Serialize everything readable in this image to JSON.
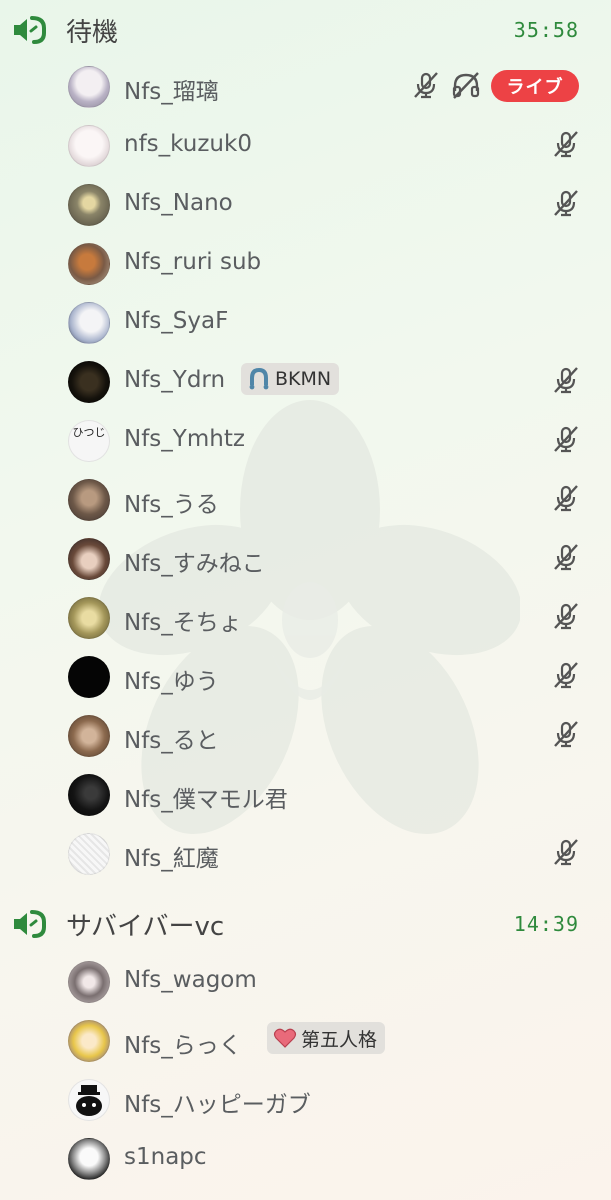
{
  "channels": [
    {
      "name": "待機",
      "timer": "35:58",
      "icon": "speaker-icon",
      "color": "#2f8a3d",
      "members": [
        {
          "name": "Nfs_瑠璃",
          "avatar_color": "#c9c5d3",
          "muted": true,
          "deafened": true,
          "live": true,
          "live_label": "ライブ"
        },
        {
          "name": "nfs_kuzuk0",
          "avatar_color": "#efe9ea",
          "muted": true
        },
        {
          "name": "Nfs_Nano",
          "avatar_color": "#6e6a5a",
          "muted": true
        },
        {
          "name": "Nfs_ruri sub",
          "avatar_color": "#8a6f55",
          "muted": false
        },
        {
          "name": "Nfs_SyaF",
          "avatar_color": "#d6dce8",
          "muted": false
        },
        {
          "name": "Nfs_Ydrn",
          "avatar_color": "#1a1712",
          "muted": true,
          "badge": {
            "text": "BKMN",
            "icon": "horseshoe-icon"
          }
        },
        {
          "name": "Nfs_Ymhtz",
          "avatar_color": "#f2f2f2",
          "avatar_text": "ひつじ",
          "muted": true
        },
        {
          "name": "Nfs_うる",
          "avatar_color": "#7c6450",
          "muted": true
        },
        {
          "name": "Nfs_すみねこ",
          "avatar_color": "#4d3a36",
          "muted": true
        },
        {
          "name": "Nfs_そちょ",
          "avatar_color": "#a49a5a",
          "muted": true
        },
        {
          "name": "Nfs_ゆう",
          "avatar_color": "#050505",
          "muted": true
        },
        {
          "name": "Nfs_ると",
          "avatar_color": "#8c6a4e",
          "muted": true
        },
        {
          "name": "Nfs_僕マモル君",
          "avatar_color": "#141414",
          "muted": false
        },
        {
          "name": "Nfs_紅魔",
          "avatar_color": "#f4f4f4",
          "muted": true
        }
      ]
    },
    {
      "name": "サバイバーvc",
      "timer": "14:39",
      "icon": "speaker-icon",
      "color": "#2f8a3d",
      "members": [
        {
          "name": "Nfs_wagom",
          "avatar_color": "#cfc6c6",
          "muted": false
        },
        {
          "name": "Nfs_らっく",
          "avatar_color": "#e8c64a",
          "muted": false,
          "badge": {
            "text": "第五人格",
            "icon": "heart-icon"
          }
        },
        {
          "name": "Nfs_ハッピーガブ",
          "avatar_color": "#f5f5f5",
          "muted": false
        },
        {
          "name": "s1napc",
          "avatar_color": "#efefef",
          "muted": false
        }
      ]
    }
  ]
}
